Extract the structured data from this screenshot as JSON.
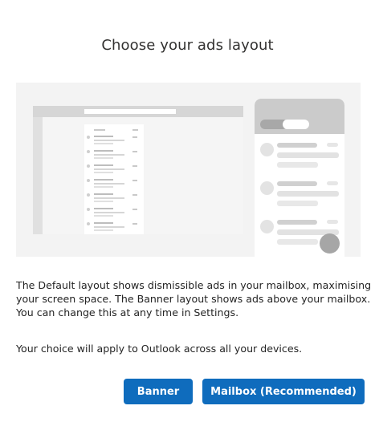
{
  "dialog": {
    "title": "Choose your ads layout",
    "description_lines": [
      "The Default layout shows dismissible ads in your mailbox, maximising",
      "your screen space. The Banner layout shows ads above your mailbox.",
      "You can change this at any time in Settings."
    ],
    "note": "Your choice will apply to Outlook across all your devices.",
    "buttons": {
      "banner_label": "Banner",
      "mailbox_label": "Mailbox (Recommended)"
    }
  },
  "colors": {
    "primary_button": "#0f6cbd",
    "illustration_background": "#f3f3f3"
  }
}
